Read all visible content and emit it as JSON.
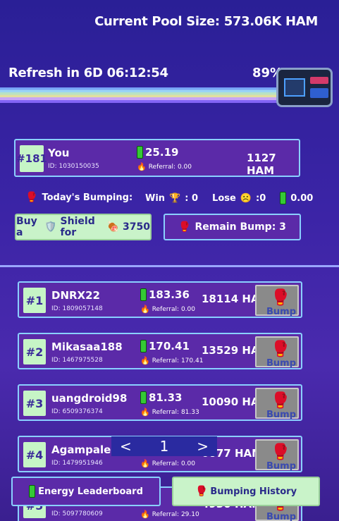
{
  "header": {
    "pool_size": "Current Pool Size: 573.06K HAM",
    "refresh": "Refresh in 6D 06:12:54",
    "progress_percent": "89%"
  },
  "my_entry": {
    "rank": "#181",
    "name": "You",
    "id": "ID: 1030150035",
    "energy": "25.19",
    "referral": "Referral: 0.00",
    "ham": "1127 HAM"
  },
  "today": {
    "label": "Today's Bumping:",
    "win_label": "Win",
    "win_value": ": 0",
    "lose_label": "Lose",
    "lose_value": ":0",
    "energy_value": "0.00"
  },
  "actions": {
    "shield_buy": "Buy a",
    "shield_for": "Shield for",
    "shield_price": "3750",
    "remain_bump": "Remain Bump: 3"
  },
  "leaderboard": [
    {
      "rank": "#1",
      "name": "DNRX22",
      "id": "ID: 1809057148",
      "energy": "183.36",
      "referral": "Referral: 0.00",
      "ham": "18114 HAM",
      "bump": "Bump"
    },
    {
      "rank": "#2",
      "name": "Mikasaa188",
      "id": "ID: 1467975528",
      "energy": "170.41",
      "referral": "Referral: 170.41",
      "ham": "13529 HAM",
      "bump": "Bump"
    },
    {
      "rank": "#3",
      "name": "uangdroid98",
      "id": "ID: 6509376374",
      "energy": "81.33",
      "referral": "Referral: 81.33",
      "ham": "10090 HAM",
      "bump": "Bump"
    },
    {
      "rank": "#4",
      "name": "Agampale",
      "id": "ID: 1479951946",
      "energy": "",
      "referral": "Referral: 0.00",
      "ham": "6077 HAM",
      "bump": "Bump"
    },
    {
      "rank": "#5",
      "name": "",
      "id": "ID: 5097780609",
      "energy": "",
      "referral": "Referral: 29.10",
      "ham": "4930 HAM",
      "bump": "Bump"
    }
  ],
  "pager": {
    "prev": "<",
    "page": "1",
    "next": ">"
  },
  "bottom_tabs": {
    "energy_leaderboard": "Energy Leaderboard",
    "bumping_history": "Bumping History"
  }
}
